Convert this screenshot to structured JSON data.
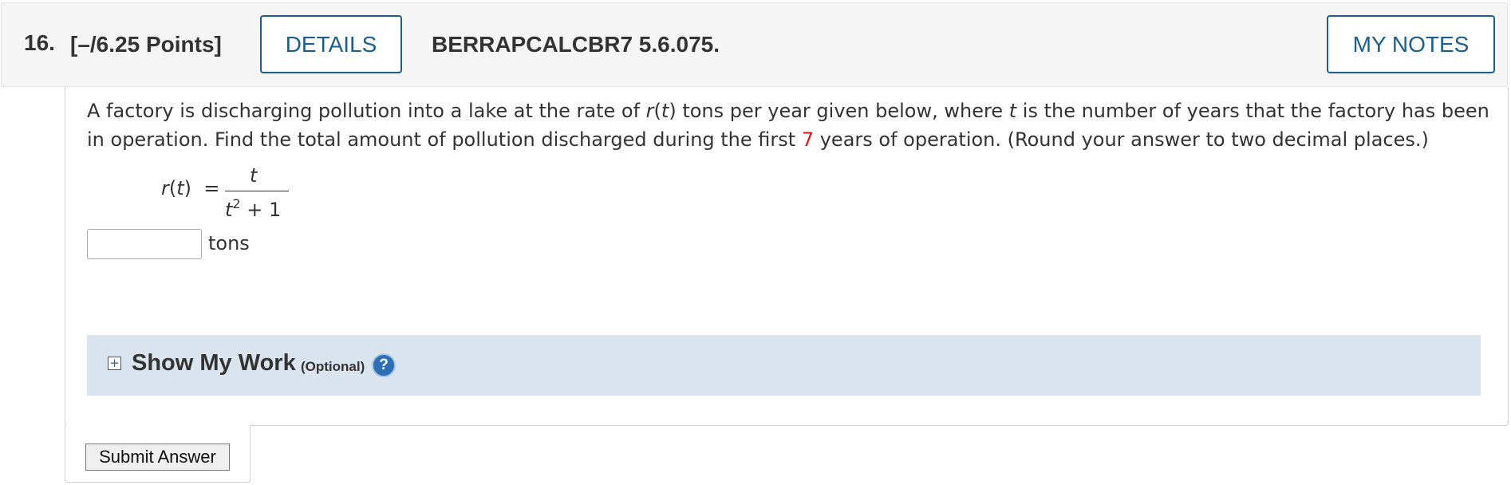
{
  "header": {
    "question_number": "16.",
    "points": "[–/6.25 Points]",
    "details_label": "DETAILS",
    "problem_code": "BERRAPCALCBR7 5.6.075.",
    "my_notes_label": "MY NOTES"
  },
  "question": {
    "line1_a": "A factory is discharging pollution into a lake at the rate of ",
    "line1_r": "r",
    "line1_b": "(",
    "line1_t": "t",
    "line1_c": ") tons per year given below, where ",
    "line1_t2": "t",
    "line1_d": " is the number of years that the factory has been",
    "line2_a": "in operation. Find the total amount of pollution discharged during the first ",
    "line2_years": "7",
    "line2_b": " years of operation. (Round your answer to two decimal places.)"
  },
  "formula": {
    "lhs_func": "r",
    "lhs_var": "t",
    "equals": "=",
    "numerator": "t",
    "denominator_base": "t",
    "denominator_exp": "2",
    "denominator_rest": " + 1"
  },
  "answer": {
    "value": "",
    "placeholder": "",
    "unit": "tons"
  },
  "show_work": {
    "title": "Show My Work",
    "optional": "(Optional)",
    "expand_symbol": "+",
    "help_symbol": "?"
  },
  "submit": {
    "label": "Submit Answer"
  },
  "colors": {
    "accent": "#1a5f8e",
    "highlight_number": "#e0171a",
    "work_bar": "#d9e4ee"
  }
}
